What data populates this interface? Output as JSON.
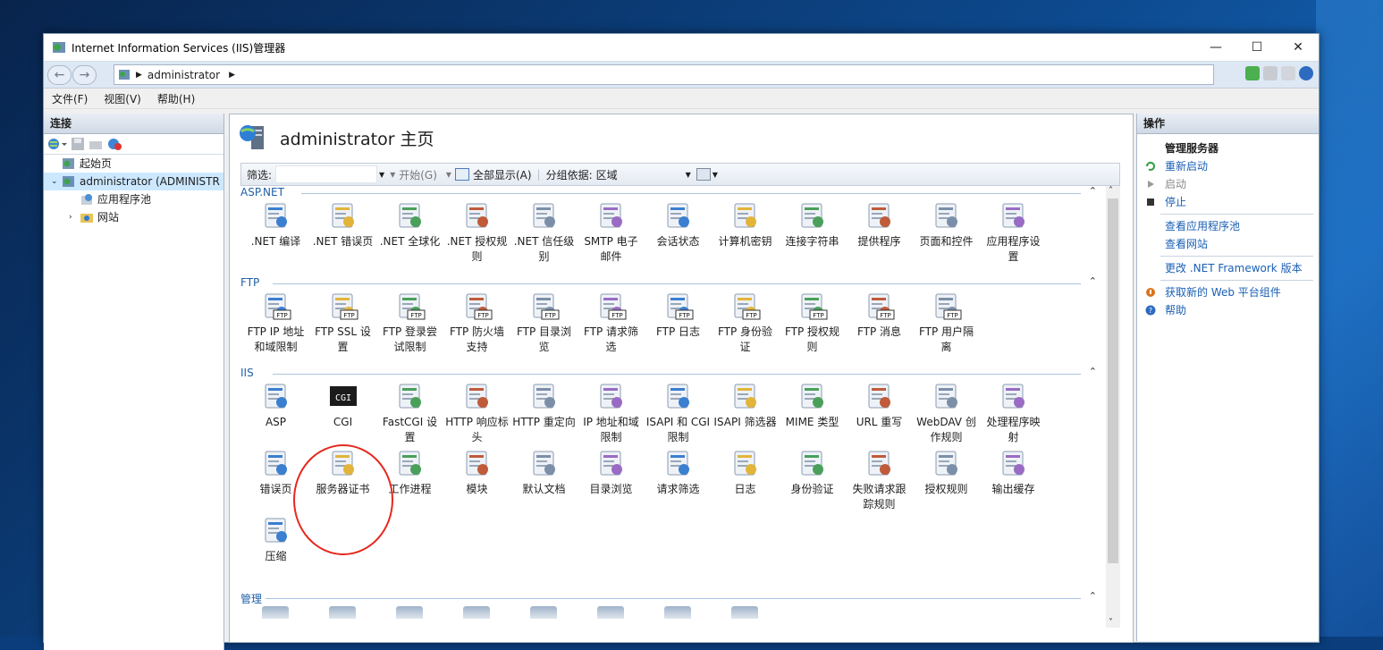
{
  "window": {
    "title": "Internet Information Services (IIS)管理器"
  },
  "address": {
    "crumb": "administrator"
  },
  "menu": [
    "文件(F)",
    "视图(V)",
    "帮助(H)"
  ],
  "connections": {
    "header": "连接",
    "tree": [
      "起始页",
      "administrator (ADMINISTR",
      "应用程序池",
      "网站"
    ]
  },
  "main": {
    "title": "administrator 主页",
    "filter_label": "筛选:",
    "start_label": "开始(G)",
    "show_all_label": "全部显示(A)",
    "group_label": "分组依据:",
    "group_value": "区域"
  },
  "sections": [
    "ASP.NET",
    "FTP",
    "IIS",
    "管理"
  ],
  "aspnet": [
    ".NET 编译",
    ".NET 错误页",
    ".NET 全球化",
    ".NET 授权规\n则",
    ".NET 信任级\n别",
    "SMTP 电子\n邮件",
    "会话状态",
    "计算机密钥",
    "连接字符串",
    "提供程序",
    "页面和控件",
    "应用程序设\n置"
  ],
  "ftp": [
    "FTP IP 地址\n和域限制",
    "FTP SSL 设\n置",
    "FTP 登录尝\n试限制",
    "FTP 防火墙\n支持",
    "FTP 目录浏\n览",
    "FTP 请求筛\n选",
    "FTP 日志",
    "FTP 身份验\n证",
    "FTP 授权规\n则",
    "FTP 消息",
    "FTP 用户隔\n离"
  ],
  "iis": [
    "ASP",
    "CGI",
    "FastCGI 设\n置",
    "HTTP 响应标\n头",
    "HTTP 重定向",
    "IP 地址和域\n限制",
    "ISAPI 和 CGI\n限制",
    "ISAPI 筛选器",
    "MIME 类型",
    "URL 重写",
    "WebDAV 创\n作规则",
    "处理程序映\n射",
    "错误页",
    "服务器证书",
    "工作进程",
    "模块",
    "默认文档",
    "目录浏览",
    "请求筛选",
    "日志",
    "身份验证",
    "失败请求跟\n踪规则",
    "授权规则",
    "输出缓存",
    "压缩"
  ],
  "actions": {
    "header": "操作",
    "manage_server": "管理服务器",
    "restart": "重新启动",
    "start": "启动",
    "stop": "停止",
    "view_pools": "查看应用程序池",
    "view_sites": "查看网站",
    "change_net": "更改 .NET Framework 版本",
    "get_web": "获取新的 Web 平台组件",
    "help": "帮助"
  },
  "icons": {
    "colors": {
      "accent": "#1a5fb4",
      "circle": "#e6281e"
    },
    "cgi_text": "CGI",
    "ftp_badge": "FTP"
  }
}
